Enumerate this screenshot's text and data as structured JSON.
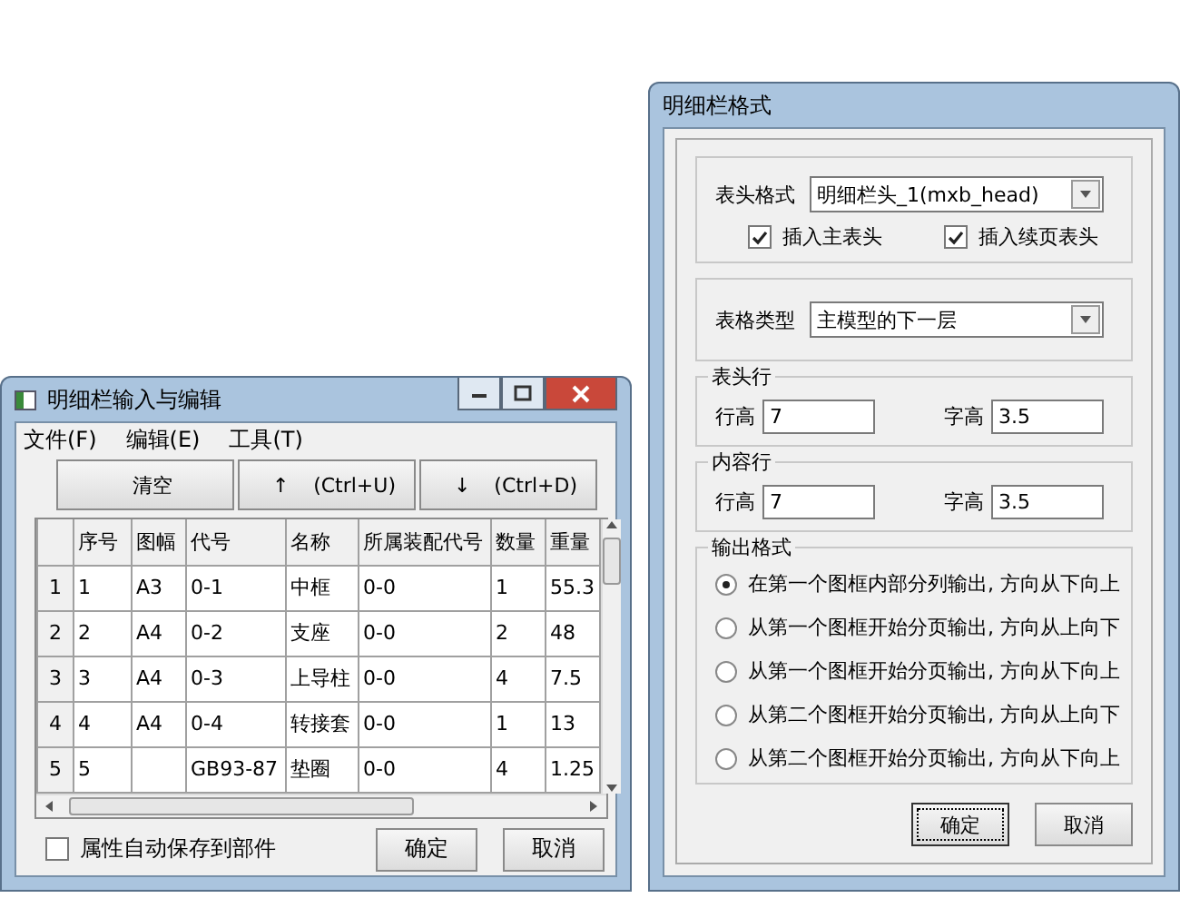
{
  "list_window": {
    "title": "明细栏输入与编辑",
    "menu": [
      "文件(F)",
      "编辑(E)",
      "工具(T)"
    ],
    "toolbar": [
      {
        "kind": "text",
        "label": "清空"
      },
      {
        "kind": "arrow",
        "arrow": "↑",
        "label": "(Ctrl+U)"
      },
      {
        "kind": "arrow",
        "arrow": "↓",
        "label": "(Ctrl+D)"
      }
    ],
    "table": {
      "columns": [
        "序号",
        "图幅",
        "代号",
        "名称",
        "所属装配代号",
        "数量",
        "重量"
      ],
      "rows": [
        {
          "number": "1",
          "cells": [
            "1",
            "A3",
            "0-1",
            "中框",
            "0-0",
            "1",
            "55.3"
          ]
        },
        {
          "number": "2",
          "cells": [
            "2",
            "A4",
            "0-2",
            "支座",
            "0-0",
            "2",
            "48"
          ]
        },
        {
          "number": "3",
          "cells": [
            "3",
            "A4",
            "0-3",
            "上导柱",
            "0-0",
            "4",
            "7.5"
          ]
        },
        {
          "number": "4",
          "cells": [
            "4",
            "A4",
            "0-4",
            "转接套",
            "0-0",
            "1",
            "13"
          ]
        },
        {
          "number": "5",
          "cells": [
            "5",
            "",
            "GB93-87",
            "垫圈",
            "0-0",
            "4",
            "1.25"
          ]
        }
      ]
    },
    "autosave": {
      "label": "属性自动保存到部件",
      "checked": false
    },
    "buttons": [
      {
        "label": "确定",
        "default": false
      },
      {
        "label": "取消",
        "default": false
      }
    ]
  },
  "format_window": {
    "title": "明细栏格式",
    "header_format": {
      "label": "表头格式",
      "value": "明细栏头_1(mxb_head)",
      "checks": [
        {
          "label": "插入主表头",
          "checked": true
        },
        {
          "label": "插入续页表头",
          "checked": true
        }
      ]
    },
    "table_type": {
      "label": "表格类型",
      "value": "主模型的下一层"
    },
    "header_row": {
      "legend": "表头行",
      "fields": [
        {
          "label": "行高",
          "value": "7"
        },
        {
          "label": "字高",
          "value": "3.5"
        }
      ]
    },
    "content_row": {
      "legend": "内容行",
      "fields": [
        {
          "label": "行高",
          "value": "7"
        },
        {
          "label": "字高",
          "value": "3.5"
        }
      ]
    },
    "output_format": {
      "legend": "输出格式",
      "options": [
        {
          "label": "在第一个图框内部分列输出, 方向从下向上",
          "selected": true
        },
        {
          "label": "从第一个图框开始分页输出, 方向从上向下",
          "selected": false
        },
        {
          "label": "从第一个图框开始分页输出, 方向从下向上",
          "selected": false
        },
        {
          "label": "从第二个图框开始分页输出, 方向从上向下",
          "selected": false
        },
        {
          "label": "从第二个图框开始分页输出, 方向从下向上",
          "selected": false
        }
      ]
    },
    "buttons": [
      {
        "label": "确定",
        "default": true
      },
      {
        "label": "取消",
        "default": false
      }
    ]
  }
}
